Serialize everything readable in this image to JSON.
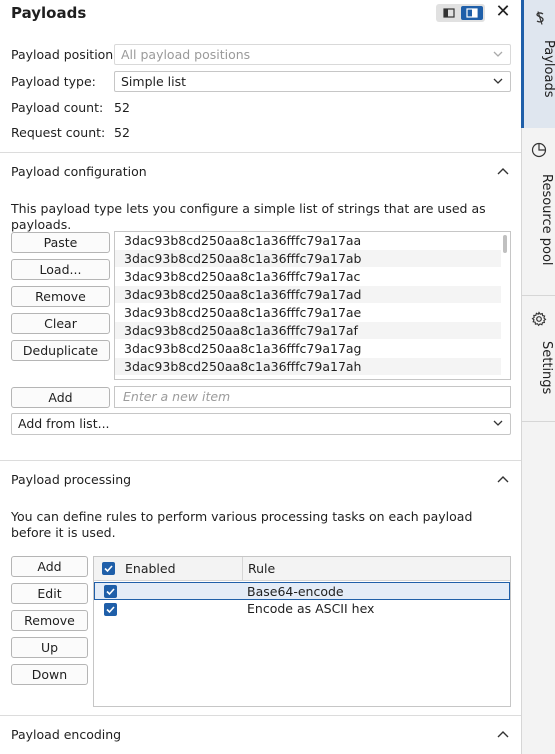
{
  "header": {
    "title": "Payloads"
  },
  "positions": {
    "payload_position_label": "Payload position:",
    "payload_position_value": "All payload positions",
    "payload_type_label": "Payload type:",
    "payload_type_value": "Simple list",
    "payload_count_label": "Payload count:",
    "payload_count_value": "52",
    "request_count_label": "Request count:",
    "request_count_value": "52"
  },
  "config": {
    "title": "Payload configuration",
    "description": "This payload type lets you configure a simple list of strings that are used as payloads.",
    "buttons": {
      "paste": "Paste",
      "load": "Load...",
      "remove": "Remove",
      "clear": "Clear",
      "dedupe": "Deduplicate",
      "add": "Add"
    },
    "items": [
      "3dac93b8cd250aa8c1a36fffc79a17aa",
      "3dac93b8cd250aa8c1a36fffc79a17ab",
      "3dac93b8cd250aa8c1a36fffc79a17ac",
      "3dac93b8cd250aa8c1a36fffc79a17ad",
      "3dac93b8cd250aa8c1a36fffc79a17ae",
      "3dac93b8cd250aa8c1a36fffc79a17af",
      "3dac93b8cd250aa8c1a36fffc79a17ag",
      "3dac93b8cd250aa8c1a36fffc79a17ah"
    ],
    "new_item_placeholder": "Enter a new item",
    "add_from_list": "Add from list..."
  },
  "processing": {
    "title": "Payload processing",
    "description": "You can define rules to perform various processing tasks on each payload before it is used.",
    "buttons": {
      "add": "Add",
      "edit": "Edit",
      "remove": "Remove",
      "up": "Up",
      "down": "Down"
    },
    "columns": {
      "enabled": "Enabled",
      "rule": "Rule"
    },
    "rules": [
      {
        "rule": "Base64-encode",
        "enabled": true
      },
      {
        "rule": "Encode as ASCII hex",
        "enabled": true
      }
    ]
  },
  "encoding": {
    "title": "Payload encoding"
  },
  "side_tabs": {
    "payloads": "Payloads",
    "resource_pool": "Resource pool",
    "settings": "Settings"
  },
  "colors": {
    "accent": "#1f5fa9",
    "selection": "#e4ecf7"
  }
}
